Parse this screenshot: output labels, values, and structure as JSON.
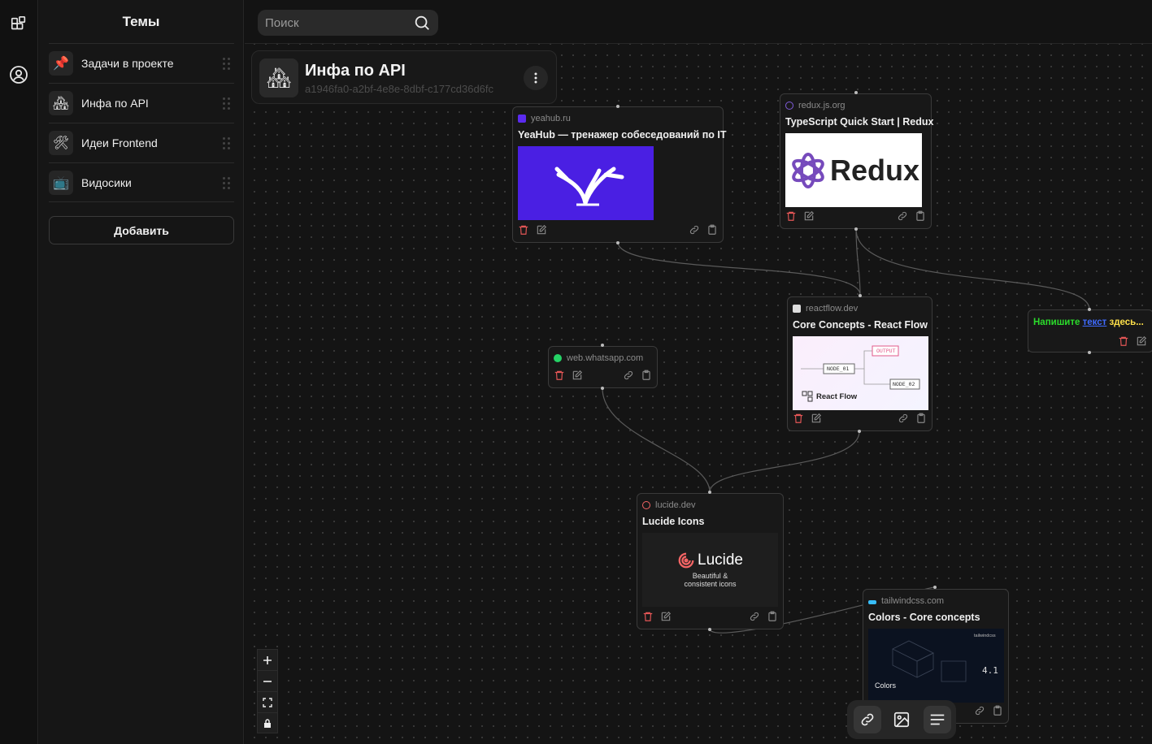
{
  "sidebar": {
    "title": "Темы",
    "items": [
      {
        "emoji": "📌",
        "label": "Задачи в проекте"
      },
      {
        "emoji": "🏘",
        "label": "Инфа по API"
      },
      {
        "emoji": "🛠",
        "label": "Идеи Frontend"
      },
      {
        "emoji": "📺",
        "label": "Видосики"
      }
    ],
    "add_label": "Добавить"
  },
  "rail": {
    "icons": [
      "widgets-icon",
      "user-circle-icon"
    ]
  },
  "search": {
    "placeholder": "Поиск"
  },
  "topic": {
    "emoji": "🏘",
    "title": "Инфа по API",
    "id": "a1946fa0-a2bf-4e8e-8dbf-c177cd36d6fc"
  },
  "nodes": {
    "yeahub": {
      "domain": "yeahub.ru",
      "title": "YeaHub — тренажер собеседований по IT"
    },
    "redux": {
      "domain": "redux.js.org",
      "title": "TypeScript Quick Start | Redux",
      "logo_text": "Redux"
    },
    "reactflow": {
      "domain": "reactflow.dev",
      "title": "Core Concepts - React Flow",
      "output": "OUTPUT",
      "node1": "NODE_01",
      "node2": "NODE_02",
      "brand": "React Flow"
    },
    "text": {
      "p1": "Напишите ",
      "p2": "текст",
      "p3": " здесь..."
    },
    "whatsapp": {
      "domain": "web.whatsapp.com"
    },
    "lucide": {
      "domain": "lucide.dev",
      "title": "Lucide Icons",
      "brand": "Lucide",
      "tagline1": "Beautiful &",
      "tagline2": "consistent icons"
    },
    "tailwind": {
      "domain": "tailwindcss.com",
      "title": "Colors - Core concepts",
      "brand": "tailwindcss",
      "thumb_title": "Colors",
      "version": "4.1"
    }
  },
  "colors": {
    "accent_yeahub": "#4a1fe3",
    "text_green": "#2bdc2b",
    "text_blue": "#3f6bff",
    "text_yellow": "#ffe14a",
    "danger": "#e45656"
  }
}
